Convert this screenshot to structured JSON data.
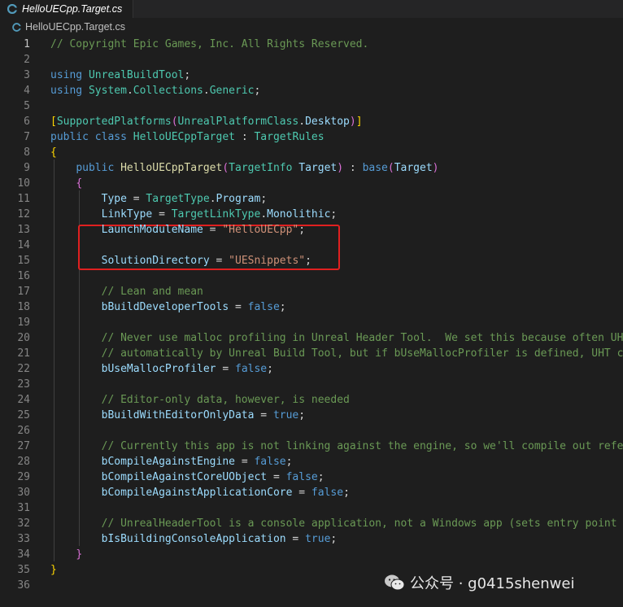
{
  "tab": {
    "title": "HelloUECpp.Target.cs",
    "icon": "csharp-file-icon"
  },
  "breadcrumb": {
    "file": "HelloUECpp.Target.cs",
    "icon": "csharp-file-icon"
  },
  "editor": {
    "current_line": 1,
    "colors": {
      "comment": "#6a9955",
      "keyword": "#569cd6",
      "type": "#4ec9b0",
      "string": "#ce9178",
      "func": "#dcdcaa",
      "variable": "#9cdcfe",
      "plain": "#d4d4d4",
      "bracket1": "#ffd700",
      "bracket2": "#da70d6",
      "bracket3": "#179fff"
    },
    "lines": [
      {
        "n": "1",
        "tokens": [
          {
            "t": "// Copyright Epic Games, Inc. All Rights Reserved.",
            "c": "comment"
          }
        ]
      },
      {
        "n": "2",
        "tokens": []
      },
      {
        "n": "3",
        "tokens": [
          {
            "t": "using",
            "c": "keyword"
          },
          {
            "t": " ",
            "c": "plain"
          },
          {
            "t": "UnrealBuildTool",
            "c": "type"
          },
          {
            "t": ";",
            "c": "plain"
          }
        ]
      },
      {
        "n": "4",
        "tokens": [
          {
            "t": "using",
            "c": "keyword"
          },
          {
            "t": " ",
            "c": "plain"
          },
          {
            "t": "System",
            "c": "type"
          },
          {
            "t": ".",
            "c": "plain"
          },
          {
            "t": "Collections",
            "c": "type"
          },
          {
            "t": ".",
            "c": "plain"
          },
          {
            "t": "Generic",
            "c": "type"
          },
          {
            "t": ";",
            "c": "plain"
          }
        ]
      },
      {
        "n": "5",
        "tokens": []
      },
      {
        "n": "6",
        "tokens": [
          {
            "t": "[",
            "c": "bracket1"
          },
          {
            "t": "SupportedPlatforms",
            "c": "type"
          },
          {
            "t": "(",
            "c": "bracket2"
          },
          {
            "t": "UnrealPlatformClass",
            "c": "type"
          },
          {
            "t": ".",
            "c": "plain"
          },
          {
            "t": "Desktop",
            "c": "variable"
          },
          {
            "t": ")",
            "c": "bracket2"
          },
          {
            "t": "]",
            "c": "bracket1"
          }
        ]
      },
      {
        "n": "7",
        "tokens": [
          {
            "t": "public",
            "c": "keyword"
          },
          {
            "t": " ",
            "c": "plain"
          },
          {
            "t": "class",
            "c": "keyword"
          },
          {
            "t": " ",
            "c": "plain"
          },
          {
            "t": "HelloUECppTarget",
            "c": "type"
          },
          {
            "t": " : ",
            "c": "plain"
          },
          {
            "t": "TargetRules",
            "c": "type"
          }
        ]
      },
      {
        "n": "8",
        "tokens": [
          {
            "t": "{",
            "c": "bracket1"
          }
        ]
      },
      {
        "n": "9",
        "tokens": [
          {
            "t": "    ",
            "c": "plain"
          },
          {
            "t": "public",
            "c": "keyword"
          },
          {
            "t": " ",
            "c": "plain"
          },
          {
            "t": "HelloUECppTarget",
            "c": "func"
          },
          {
            "t": "(",
            "c": "bracket2"
          },
          {
            "t": "TargetInfo",
            "c": "type"
          },
          {
            "t": " ",
            "c": "plain"
          },
          {
            "t": "Target",
            "c": "variable"
          },
          {
            "t": ")",
            "c": "bracket2"
          },
          {
            "t": " : ",
            "c": "plain"
          },
          {
            "t": "base",
            "c": "keyword"
          },
          {
            "t": "(",
            "c": "bracket2"
          },
          {
            "t": "Target",
            "c": "variable"
          },
          {
            "t": ")",
            "c": "bracket2"
          }
        ]
      },
      {
        "n": "10",
        "tokens": [
          {
            "t": "    ",
            "c": "plain"
          },
          {
            "t": "{",
            "c": "bracket2"
          }
        ]
      },
      {
        "n": "11",
        "tokens": [
          {
            "t": "        ",
            "c": "plain"
          },
          {
            "t": "Type",
            "c": "variable"
          },
          {
            "t": " = ",
            "c": "plain"
          },
          {
            "t": "TargetType",
            "c": "type"
          },
          {
            "t": ".",
            "c": "plain"
          },
          {
            "t": "Program",
            "c": "variable"
          },
          {
            "t": ";",
            "c": "plain"
          }
        ]
      },
      {
        "n": "12",
        "tokens": [
          {
            "t": "        ",
            "c": "plain"
          },
          {
            "t": "LinkType",
            "c": "variable"
          },
          {
            "t": " = ",
            "c": "plain"
          },
          {
            "t": "TargetLinkType",
            "c": "type"
          },
          {
            "t": ".",
            "c": "plain"
          },
          {
            "t": "Monolithic",
            "c": "variable"
          },
          {
            "t": ";",
            "c": "plain"
          }
        ]
      },
      {
        "n": "13",
        "tokens": [
          {
            "t": "        ",
            "c": "plain"
          },
          {
            "t": "LaunchModuleName",
            "c": "variable"
          },
          {
            "t": " = ",
            "c": "plain"
          },
          {
            "t": "\"HelloUECpp\"",
            "c": "string"
          },
          {
            "t": ";",
            "c": "plain"
          }
        ]
      },
      {
        "n": "14",
        "tokens": []
      },
      {
        "n": "15",
        "tokens": [
          {
            "t": "        ",
            "c": "plain"
          },
          {
            "t": "SolutionDirectory",
            "c": "variable"
          },
          {
            "t": " = ",
            "c": "plain"
          },
          {
            "t": "\"UESnippets\"",
            "c": "string"
          },
          {
            "t": ";",
            "c": "plain"
          }
        ]
      },
      {
        "n": "16",
        "tokens": []
      },
      {
        "n": "17",
        "tokens": [
          {
            "t": "        ",
            "c": "plain"
          },
          {
            "t": "// Lean and mean",
            "c": "comment"
          }
        ]
      },
      {
        "n": "18",
        "tokens": [
          {
            "t": "        ",
            "c": "plain"
          },
          {
            "t": "bBuildDeveloperTools",
            "c": "variable"
          },
          {
            "t": " = ",
            "c": "plain"
          },
          {
            "t": "false",
            "c": "keyword"
          },
          {
            "t": ";",
            "c": "plain"
          }
        ]
      },
      {
        "n": "19",
        "tokens": []
      },
      {
        "n": "20",
        "tokens": [
          {
            "t": "        ",
            "c": "plain"
          },
          {
            "t": "// Never use malloc profiling in Unreal Header Tool.  We set this because often UHT",
            "c": "comment"
          }
        ]
      },
      {
        "n": "21",
        "tokens": [
          {
            "t": "        ",
            "c": "plain"
          },
          {
            "t": "// automatically by Unreal Build Tool, but if bUseMallocProfiler is defined, UHT can",
            "c": "comment"
          }
        ]
      },
      {
        "n": "22",
        "tokens": [
          {
            "t": "        ",
            "c": "plain"
          },
          {
            "t": "bUseMallocProfiler",
            "c": "variable"
          },
          {
            "t": " = ",
            "c": "plain"
          },
          {
            "t": "false",
            "c": "keyword"
          },
          {
            "t": ";",
            "c": "plain"
          }
        ]
      },
      {
        "n": "23",
        "tokens": []
      },
      {
        "n": "24",
        "tokens": [
          {
            "t": "        ",
            "c": "plain"
          },
          {
            "t": "// Editor-only data, however, is needed",
            "c": "comment"
          }
        ]
      },
      {
        "n": "25",
        "tokens": [
          {
            "t": "        ",
            "c": "plain"
          },
          {
            "t": "bBuildWithEditorOnlyData",
            "c": "variable"
          },
          {
            "t": " = ",
            "c": "plain"
          },
          {
            "t": "true",
            "c": "keyword"
          },
          {
            "t": ";",
            "c": "plain"
          }
        ]
      },
      {
        "n": "26",
        "tokens": []
      },
      {
        "n": "27",
        "tokens": [
          {
            "t": "        ",
            "c": "plain"
          },
          {
            "t": "// Currently this app is not linking against the engine, so we'll compile out refere",
            "c": "comment"
          }
        ]
      },
      {
        "n": "28",
        "tokens": [
          {
            "t": "        ",
            "c": "plain"
          },
          {
            "t": "bCompileAgainstEngine",
            "c": "variable"
          },
          {
            "t": " = ",
            "c": "plain"
          },
          {
            "t": "false",
            "c": "keyword"
          },
          {
            "t": ";",
            "c": "plain"
          }
        ]
      },
      {
        "n": "29",
        "tokens": [
          {
            "t": "        ",
            "c": "plain"
          },
          {
            "t": "bCompileAgainstCoreUObject",
            "c": "variable"
          },
          {
            "t": " = ",
            "c": "plain"
          },
          {
            "t": "false",
            "c": "keyword"
          },
          {
            "t": ";",
            "c": "plain"
          }
        ]
      },
      {
        "n": "30",
        "tokens": [
          {
            "t": "        ",
            "c": "plain"
          },
          {
            "t": "bCompileAgainstApplicationCore",
            "c": "variable"
          },
          {
            "t": " = ",
            "c": "plain"
          },
          {
            "t": "false",
            "c": "keyword"
          },
          {
            "t": ";",
            "c": "plain"
          }
        ]
      },
      {
        "n": "31",
        "tokens": []
      },
      {
        "n": "32",
        "tokens": [
          {
            "t": "        ",
            "c": "plain"
          },
          {
            "t": "// UnrealHeaderTool is a console application, not a Windows app (sets entry point to",
            "c": "comment"
          }
        ]
      },
      {
        "n": "33",
        "tokens": [
          {
            "t": "        ",
            "c": "plain"
          },
          {
            "t": "bIsBuildingConsoleApplication",
            "c": "variable"
          },
          {
            "t": " = ",
            "c": "plain"
          },
          {
            "t": "true",
            "c": "keyword"
          },
          {
            "t": ";",
            "c": "plain"
          }
        ]
      },
      {
        "n": "34",
        "tokens": [
          {
            "t": "    ",
            "c": "plain"
          },
          {
            "t": "}",
            "c": "bracket2"
          }
        ]
      },
      {
        "n": "35",
        "tokens": [
          {
            "t": "}",
            "c": "bracket1"
          }
        ]
      },
      {
        "n": "36",
        "tokens": []
      }
    ]
  },
  "watermark": {
    "text": "公众号 · g0415shenwei",
    "icon": "wechat-icon"
  }
}
